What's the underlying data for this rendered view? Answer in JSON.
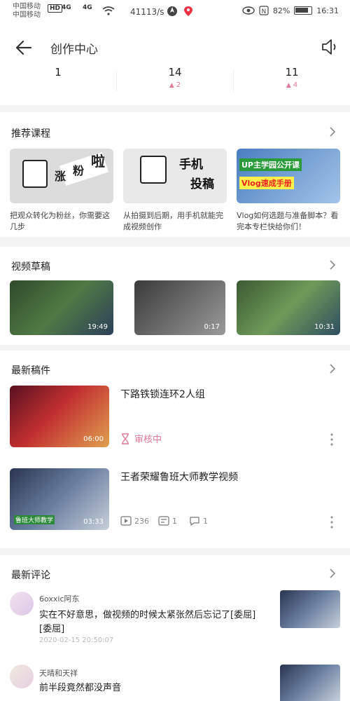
{
  "status_bar": {
    "carrier_line1": "中国移动",
    "carrier_line2": "中国移动",
    "badge_hd": "HD",
    "signal1": "4G",
    "signal2": "4G",
    "net_speed": "41113/s",
    "battery_pct": "82%",
    "time": "16:31"
  },
  "header": {
    "title": "创作中心"
  },
  "stats": [
    {
      "value": "1",
      "delta": ""
    },
    {
      "value": "14",
      "delta": "2"
    },
    {
      "value": "11",
      "delta": "4"
    }
  ],
  "courses": {
    "title": "推荐课程",
    "items": [
      {
        "thumb_text_a": "涨",
        "thumb_text_b": "粉",
        "thumb_text_c": "啦",
        "caption": "把观众转化为粉丝，你需要这几步"
      },
      {
        "thumb_text_a": "手机",
        "thumb_text_b": "投稿",
        "caption": "从拍摄到后期，用手机就能完成视频创作"
      },
      {
        "thumb_text_a": "UP主学园公开课",
        "thumb_text_b": "Vlog速成手册",
        "caption": "Vlog如何选题与准备脚本？看完本专栏快给你们！"
      }
    ]
  },
  "drafts": {
    "title": "视频草稿",
    "items": [
      {
        "duration": "19:49"
      },
      {
        "duration": "0:17"
      },
      {
        "duration": "10:31"
      }
    ]
  },
  "latest_works": {
    "title": "最新稿件",
    "items": [
      {
        "title": "下路铁锁连环2人组",
        "duration": "06:00",
        "status": "审核中"
      },
      {
        "title": "王者荣耀鲁班大师教学视频",
        "duration": "03:33",
        "overlay": "鲁班大师教学",
        "plays": "236",
        "danmaku": "1",
        "comments": "1"
      }
    ]
  },
  "latest_comments": {
    "title": "最新评论",
    "items": [
      {
        "user": "6oxxic阿东",
        "text": "实在不好意思，做视频的时候太紧张然后忘记了[委屈][委屈]",
        "time": "2020-02-15 20:50:07"
      },
      {
        "user": "天晴和天祥",
        "text": "前半段竟然都没声音"
      }
    ]
  },
  "colors": {
    "accent": "#e07a95",
    "background": "#f4f4f4",
    "card": "#ffffff"
  }
}
